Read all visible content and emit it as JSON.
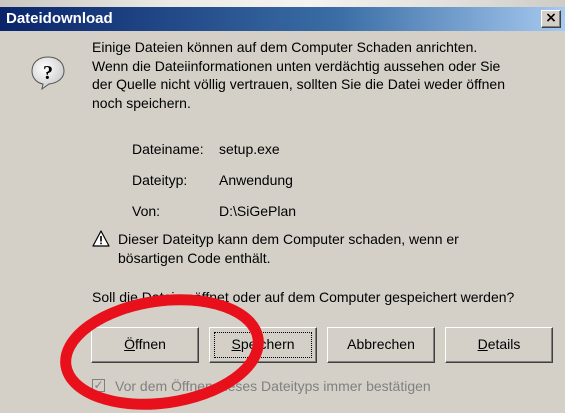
{
  "dialog": {
    "title": "Dateidownload",
    "close_label": "×",
    "message": {
      "line1": "Einige Dateien können auf dem Computer Schaden anrichten.",
      "line2": "Wenn die Dateiinformationen unten verdächtig aussehen oder Sie",
      "line3": "der Quelle nicht völlig vertrauen, sollten Sie die Datei weder öffnen",
      "line4": "noch speichern."
    },
    "file_info": {
      "name_label": "Dateiname:",
      "name_value": "setup.exe",
      "type_label": "Dateityp:",
      "type_value": "Anwendung",
      "from_label": "Von:",
      "from_value": "D:\\SiGePlan"
    },
    "warning": {
      "line1": "Dieser Dateityp kann dem Computer schaden, wenn er",
      "line2": "bösartigen Code enthält."
    },
    "question": "Soll die Datei geöffnet oder auf dem Computer gespeichert werden?",
    "buttons": {
      "open_mn": "Ö",
      "open_rest": "ffnen",
      "save_mn": "S",
      "save_rest": "peichern",
      "cancel": "Abbrechen",
      "details_mn": "D",
      "details_rest": "etails"
    },
    "checkbox": {
      "label": "Vor dem Öffnen dieses Dateityps immer bestätigen",
      "checked": true,
      "mark": "✓"
    },
    "icons": {
      "question": "question-icon",
      "warning": "warning-icon",
      "close": "close-icon"
    },
    "colors": {
      "titlebar_start": "#0a246a",
      "titlebar_end": "#a6caf0",
      "face": "#d4d0c8",
      "annotation": "#e8101a"
    }
  }
}
